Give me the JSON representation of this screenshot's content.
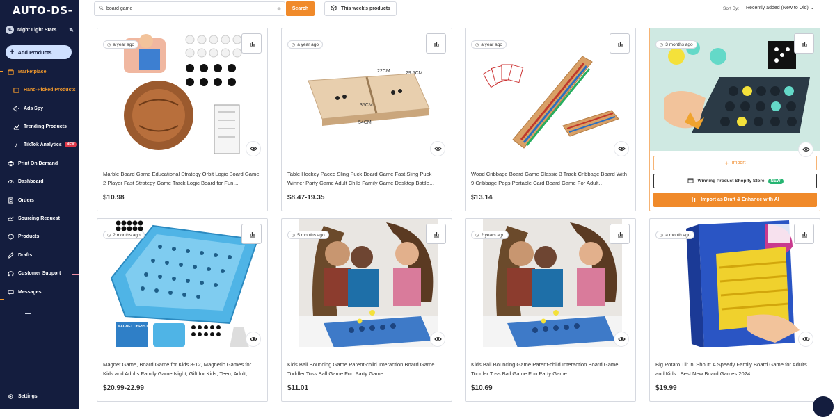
{
  "app": {
    "logo": "AUTO-DS-"
  },
  "sidebar": {
    "store_initials": "NL",
    "store_name": "Night Light Stars",
    "add_products": "Add Products",
    "items": [
      {
        "label": "Marketplace",
        "icon": "marketplace-icon",
        "active": true
      },
      {
        "label": "Hand-Picked Products",
        "icon": "box-icon",
        "active": true,
        "sub": true
      },
      {
        "label": "Ads Spy",
        "icon": "megaphone-icon",
        "sub": true
      },
      {
        "label": "Trending Products",
        "icon": "trend-icon",
        "sub": true
      },
      {
        "label": "TikTok Analytics",
        "icon": "tiktok-icon",
        "sub": true,
        "badge": "NEW"
      },
      {
        "label": "Print On Demand",
        "icon": "print-icon"
      },
      {
        "label": "Dashboard",
        "icon": "dashboard-icon"
      },
      {
        "label": "Orders",
        "icon": "orders-icon"
      },
      {
        "label": "Sourcing Request",
        "icon": "sourcing-icon"
      },
      {
        "label": "Products",
        "icon": "products-icon"
      },
      {
        "label": "Drafts",
        "icon": "drafts-icon"
      },
      {
        "label": "Customer Support",
        "icon": "support-icon"
      },
      {
        "label": "Messages",
        "icon": "messages-icon"
      }
    ],
    "settings": "Settings"
  },
  "search": {
    "value": "board game",
    "button": "Search",
    "this_week": "This week's products"
  },
  "sort": {
    "label": "Sort By:",
    "value": "Recently added (New to Old)"
  },
  "products": [
    {
      "age": "a year ago",
      "title": "Marble Board Game Educational Strategy Orbit Logic Board Game 2 Player Fast Strategy Game Track Logic Board for Fun…",
      "price": "$10.98"
    },
    {
      "age": "a year ago",
      "title": "Table Hockey Paced Sling Puck Board Game Fast Sling Puck Winner Party Game Adult Child Family Game Desktop Battle…",
      "price": "$8.47-19.35",
      "dims": [
        "22CM",
        "29.5CM",
        "35CM",
        "54CM"
      ]
    },
    {
      "age": "a year ago",
      "title": "Wood Cribbage Board Game Classic 3 Track Cribbage Board With 9 Cribbage Pegs Portable Card Board Game For Adult…",
      "price": "$13.14"
    },
    {
      "age": "3 months ago",
      "import": "Import",
      "winning": "Winning Product Shopify Store",
      "winning_badge": "NEW",
      "draft": "Import as Draft & Enhance with AI"
    },
    {
      "age": "2 months ago",
      "title": "Magnet Game, Board Game for Kids 8-12, Magnetic Games for Kids and Adults Family Game Night, Gift for Kids, Teen, Adult, …",
      "price": "$20.99-22.99",
      "box_text": "MAGNET CHESS GAME"
    },
    {
      "age": "5 months ago",
      "title": "Kids Ball Bouncing Game Parent-child Interaction Board Game Toddler Toss Ball Game Fun Party Game",
      "price": "$11.01"
    },
    {
      "age": "2 years ago",
      "title": "Kids Ball Bouncing Game Parent-child Interaction Board Game Toddler Toss Ball Game Fun Party Game",
      "price": "$10.69"
    },
    {
      "age": "a month ago",
      "title": "Big Potato Tilt 'n' Shout: A Speedy Family Board Game for Adults and Kids | Best New Board Games 2024",
      "price": "$19.99"
    }
  ],
  "colors": {
    "sidebar": "#141d3e",
    "accent": "#f08a2a",
    "new_badge": "#e0394a",
    "green_badge": "#26b572"
  }
}
